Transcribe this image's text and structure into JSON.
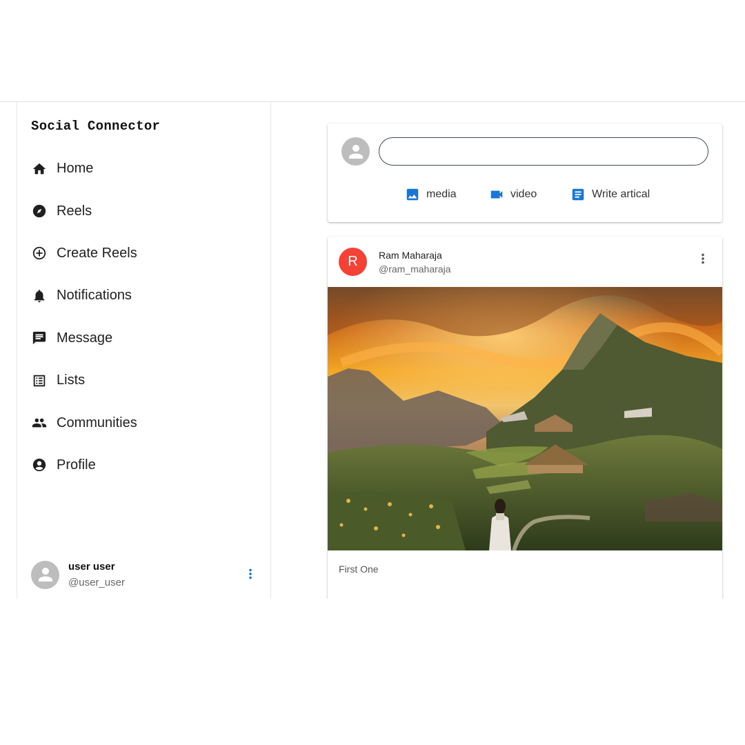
{
  "sidebar": {
    "brand": "Social Connector",
    "items": [
      {
        "label": "Home",
        "icon": "home-icon"
      },
      {
        "label": "Reels",
        "icon": "compass-icon"
      },
      {
        "label": "Create Reels",
        "icon": "add-circle-icon"
      },
      {
        "label": "Notifications",
        "icon": "bell-icon"
      },
      {
        "label": "Message",
        "icon": "message-icon"
      },
      {
        "label": "Lists",
        "icon": "list-icon"
      },
      {
        "label": "Communities",
        "icon": "group-icon"
      },
      {
        "label": "Profile",
        "icon": "account-circle-icon"
      }
    ],
    "user": {
      "name": "user user",
      "handle": "@user_user"
    }
  },
  "composer": {
    "input_value": "",
    "actions": [
      {
        "label": "media",
        "icon": "image-icon"
      },
      {
        "label": "video",
        "icon": "videocam-icon"
      },
      {
        "label": "Write artical",
        "icon": "article-icon"
      }
    ]
  },
  "post": {
    "avatar_letter": "R",
    "author_name": "Ram Maharaja",
    "author_handle": "@ram_maharaja",
    "caption": "First One"
  },
  "colors": {
    "accent": "#1976d2",
    "avatar_red": "#f44336",
    "avatar_gray": "#bdbdbd"
  }
}
